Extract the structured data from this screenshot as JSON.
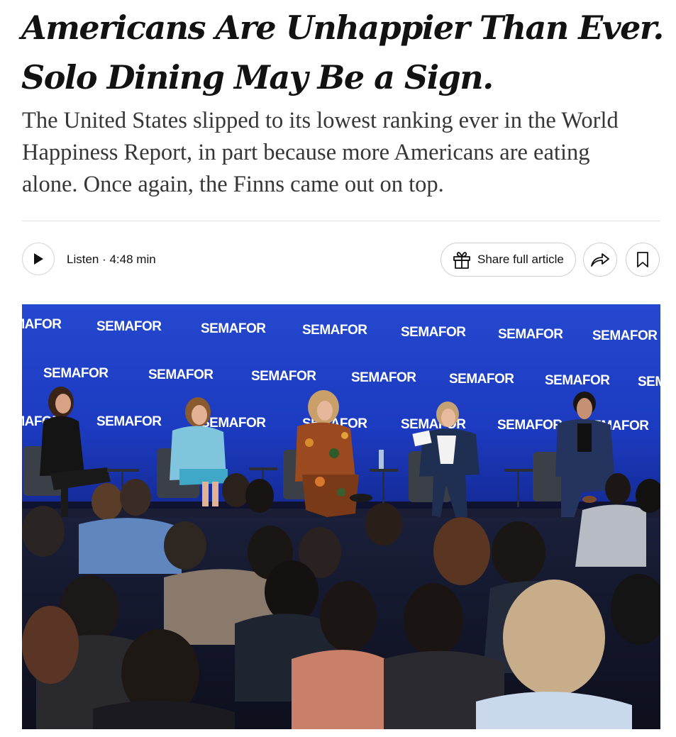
{
  "article": {
    "headline_line1": "Americans Are Unhappier Than Ever.",
    "headline_line2": "Solo Dining May Be a Sign.",
    "summary_line1": "The United States slipped to its lowest ranking ever in the World",
    "summary_line2": "Happiness Report, in part because more Americans are eating",
    "summary_line3": "alone. Once again, the Finns came out on top."
  },
  "toolbar": {
    "listen_label": "Listen · 4:48 min",
    "listen_icon": "play-icon",
    "share_full_label": "Share full article",
    "share_full_icon": "gift-icon",
    "share_icon": "share-arrow-icon",
    "save_icon": "bookmark-icon"
  },
  "photo": {
    "backdrop_brand": "SEMAFOR",
    "backdrop_color": "#1b3fbf",
    "panelists_count": 5
  }
}
